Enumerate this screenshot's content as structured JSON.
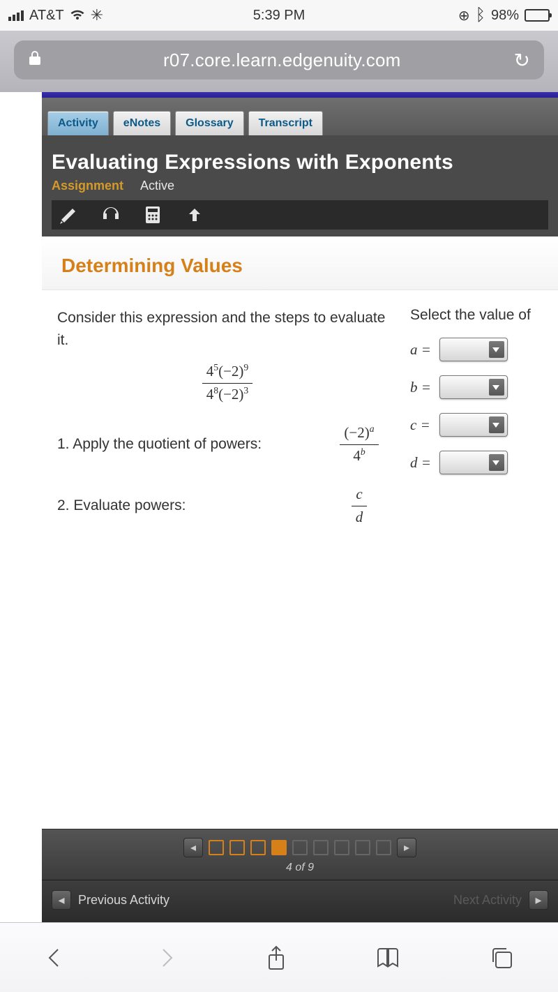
{
  "status": {
    "carrier": "AT&T",
    "time": "5:39 PM",
    "battery": "98%"
  },
  "browser": {
    "url": "r07.core.learn.edgenuity.com"
  },
  "tabs": {
    "activity": "Activity",
    "enotes": "eNotes",
    "glossary": "Glossary",
    "transcript": "Transcript"
  },
  "lesson": {
    "title": "Evaluating Expressions with Exponents",
    "assignment_label": "Assignment",
    "status": "Active"
  },
  "card": {
    "title": "Determining Values"
  },
  "prompt": "Consider this expression and the steps to evaluate it.",
  "expression": {
    "num": "4⁵(−2)⁹",
    "den": "4⁸(−2)³"
  },
  "step1": {
    "label": "1. Apply the quotient of powers:",
    "expr_num": "(−2)ᵃ",
    "expr_den": "4ᵇ"
  },
  "step2": {
    "label": "2. Evaluate powers:",
    "expr_num": "c",
    "expr_den": "d"
  },
  "right_prompt": "Select the value of",
  "vars": {
    "a": "a =",
    "b": "b =",
    "c": "c =",
    "d": "d ="
  },
  "pager": {
    "count": "4 of 9"
  },
  "nav": {
    "prev": "Previous Activity",
    "next": "Next Activity"
  }
}
